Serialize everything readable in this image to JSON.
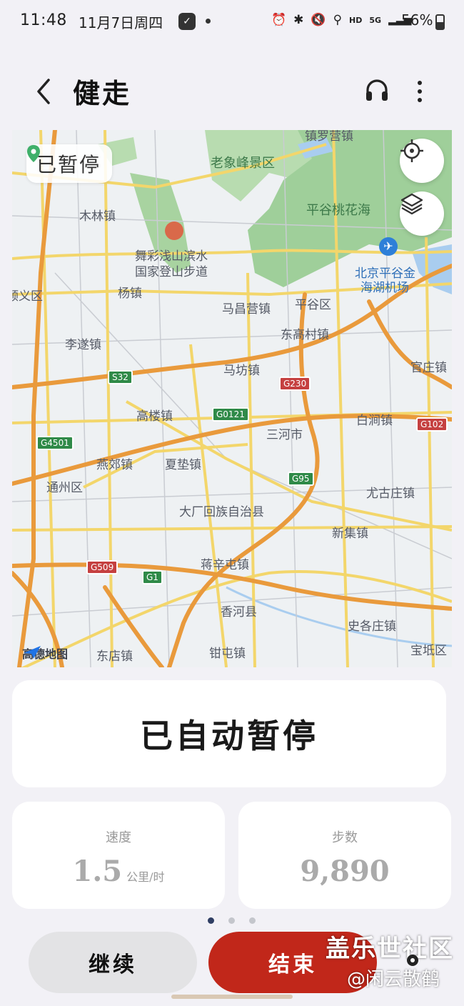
{
  "status_bar": {
    "time": "11:48",
    "date": "11月7日周四",
    "network": "HD",
    "signal": "5G",
    "battery": "56%"
  },
  "header": {
    "title": "健走"
  },
  "map": {
    "status_chip": "已暂停",
    "attribution": "高德地图",
    "labels": {
      "laoxiangfeng": "老象峰景区",
      "pinggu_taohuahai": "平谷桃花海",
      "mulinzhen": "木林镇",
      "wucai": "舞彩浅山滨水",
      "guojia": "国家登山步道",
      "airport1": "北京平谷金",
      "airport2": "海湖机场",
      "shunyiqu": "顺义区",
      "yangzhen": "杨镇",
      "machangying": "马昌营镇",
      "pingguqu": "平谷区",
      "donggaocun": "东高村镇",
      "lisuizhen": "李遂镇",
      "mafangzhen": "马坊镇",
      "guanzhuang": "官庄镇",
      "gaolouzhen": "高楼镇",
      "baijian": "白涧镇",
      "sanheshi": "三河市",
      "yanjiao": "燕郊镇",
      "xiadian": "夏垫镇",
      "tongzhou": "通州区",
      "yougu": "尤古庄镇",
      "dachang": "大厂回族自治县",
      "xinji": "新集镇",
      "jiangxintun": "蒋辛屯镇",
      "xianghe": "香河县",
      "shigezhuang": "史各庄镇",
      "baodi": "宝坻区",
      "dianzhen": "东店镇",
      "qiantun": "钳屯镇",
      "zhenluoying": "镇罗营镇"
    },
    "roads": {
      "s32": "S32",
      "g0121": "G0121",
      "g230": "G230",
      "g4501": "G4501",
      "g102": "G102",
      "g95": "G95",
      "g509": "G509",
      "g1": "G1"
    }
  },
  "status_card": {
    "text": "已自动暂停"
  },
  "metrics": {
    "speed_label": "速度",
    "speed_value": "1.5",
    "speed_unit": "公里/时",
    "steps_label": "步数",
    "steps_value": "9,890"
  },
  "pager": {
    "count": 3,
    "active_index": 0
  },
  "actions": {
    "continue_label": "继续",
    "end_label": "结束"
  },
  "watermark": {
    "line1": "盖乐世社区",
    "line2": "@闲云散鹤"
  },
  "colors": {
    "end_button": "#c1271a",
    "highway_orange": "#e99a3c",
    "road_yellow": "#f3d66b",
    "park_green": "#9fcf9a"
  }
}
